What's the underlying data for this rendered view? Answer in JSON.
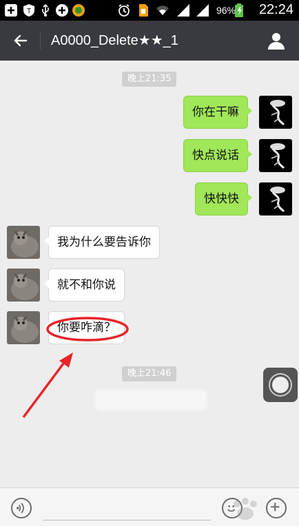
{
  "status_bar": {
    "battery_percent": "96%",
    "time": "22:24"
  },
  "header": {
    "title": "A0000_Delete★★_1"
  },
  "messages": [
    {
      "type": "time",
      "text": "晚上21:35"
    },
    {
      "type": "out",
      "text": "你在干嘛"
    },
    {
      "type": "out",
      "text": "快点说话"
    },
    {
      "type": "out",
      "text": "快快快"
    },
    {
      "type": "in",
      "text": "我为什么要告诉你"
    },
    {
      "type": "in",
      "text": "就不和你说"
    },
    {
      "type": "in",
      "text": "你要咋滴？"
    },
    {
      "type": "time",
      "text": "晚上21:46"
    }
  ],
  "colors": {
    "header_bg": "#393a3f",
    "chat_bg": "#ededed",
    "out_bubble": "#a0e759",
    "in_bubble": "#ffffff",
    "annotation_red": "#e8232a"
  }
}
